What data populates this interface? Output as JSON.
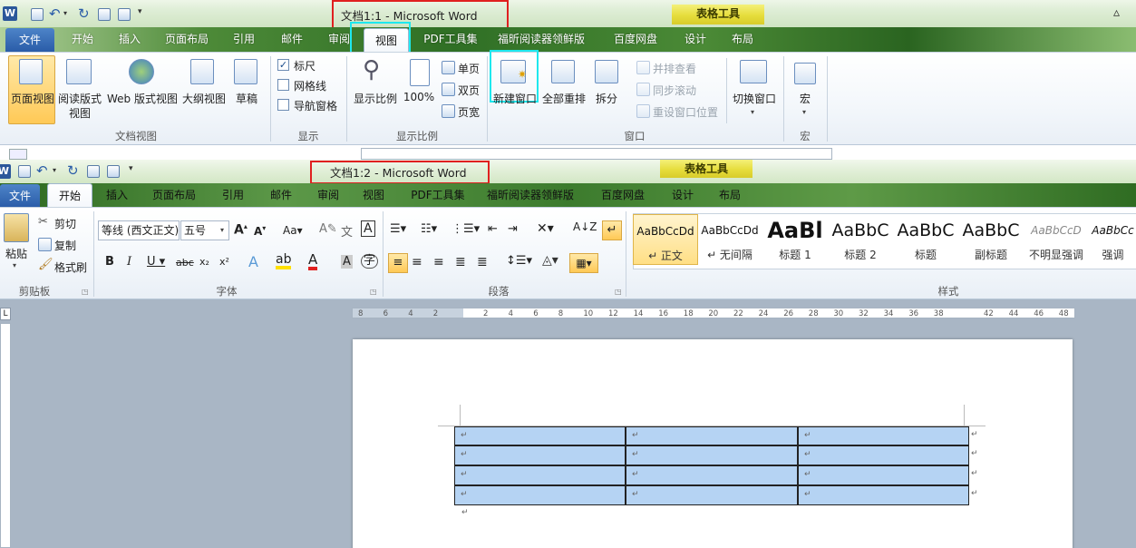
{
  "window1": {
    "title": "文档1:1  -  Microsoft Word",
    "context_tab": "表格工具",
    "tabs": [
      "文件",
      "开始",
      "插入",
      "页面布局",
      "引用",
      "邮件",
      "审阅",
      "视图",
      "PDF工具集",
      "福昕阅读器领鲜版",
      "百度网盘",
      "设计",
      "布局"
    ],
    "active_tab": "视图",
    "view_buttons": [
      "页面视图",
      "阅读版式",
      "视图",
      "Web 版式视图",
      "大纲视图",
      "草稿"
    ],
    "group_doc_views": "文档视图",
    "show_items": [
      "标尺",
      "网格线",
      "导航窗格"
    ],
    "group_show": "显示",
    "zoom_buttons": [
      "显示比例",
      "100%"
    ],
    "page_buttons": [
      "单页",
      "双页",
      "页宽"
    ],
    "group_zoom": "显示比例",
    "window_buttons": [
      "新建窗口",
      "全部重排",
      "拆分"
    ],
    "window_small": [
      "并排查看",
      "同步滚动",
      "重设窗口位置"
    ],
    "switch_window": "切换窗口",
    "group_window": "窗口",
    "macro": "宏",
    "group_macro": "宏"
  },
  "window2": {
    "title": "文档1:2  -  Microsoft Word",
    "context_tab": "表格工具",
    "tabs": [
      "文件",
      "开始",
      "插入",
      "页面布局",
      "引用",
      "邮件",
      "审阅",
      "视图",
      "PDF工具集",
      "福昕阅读器领鲜版",
      "百度网盘",
      "设计",
      "布局"
    ],
    "active_tab": "开始",
    "clipboard": {
      "paste": "粘贴",
      "cut": "剪切",
      "copy": "复制",
      "format_painter": "格式刷",
      "label": "剪贴板"
    },
    "font": {
      "name": "等线 (西文正文)",
      "size": "五号",
      "label": "字体"
    },
    "paragraph_label": "段落",
    "styles": [
      {
        "preview": "AaBbCcDd",
        "name": "↵ 正文"
      },
      {
        "preview": "AaBbCcDd",
        "name": "↵ 无间隔"
      },
      {
        "preview": "AaBl",
        "name": "标题 1"
      },
      {
        "preview": "AaBbC",
        "name": "标题 2"
      },
      {
        "preview": "AaBbC",
        "name": "标题"
      },
      {
        "preview": "AaBbC",
        "name": "副标题"
      },
      {
        "preview": "AaBbCcD",
        "name": "不明显强调"
      },
      {
        "preview": "AaBbCc",
        "name": "强调"
      }
    ],
    "styles_label": "样式",
    "ruler_numbers": [
      "8",
      "6",
      "4",
      "2",
      "",
      "2",
      "4",
      "6",
      "8",
      "10",
      "12",
      "14",
      "16",
      "18",
      "20",
      "22",
      "24",
      "26",
      "28",
      "30",
      "32",
      "34",
      "36",
      "38",
      "",
      "42",
      "44",
      "46",
      "48"
    ],
    "ruler_corner": "L"
  },
  "colors": {
    "accent": "#2b579a",
    "selection": "#b5d3f3",
    "highlight_red": "#e02020",
    "highlight_cyan": "#1ee8ee",
    "context": "#e6dd3c"
  }
}
